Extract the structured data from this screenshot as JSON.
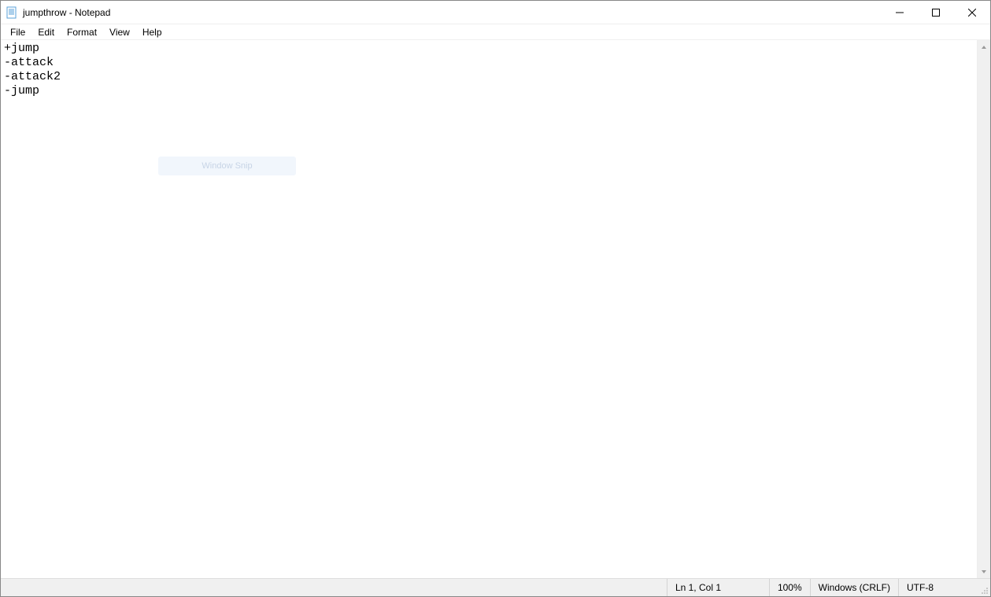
{
  "window": {
    "title": "jumpthrow - Notepad"
  },
  "menubar": {
    "items": [
      "File",
      "Edit",
      "Format",
      "View",
      "Help"
    ]
  },
  "editor": {
    "content": "+jump\n-attack\n-attack2\n-jump"
  },
  "watermark": {
    "label": "Window Snip"
  },
  "statusbar": {
    "position": "Ln 1, Col 1",
    "zoom": "100%",
    "line_ending": "Windows (CRLF)",
    "encoding": "UTF-8"
  }
}
